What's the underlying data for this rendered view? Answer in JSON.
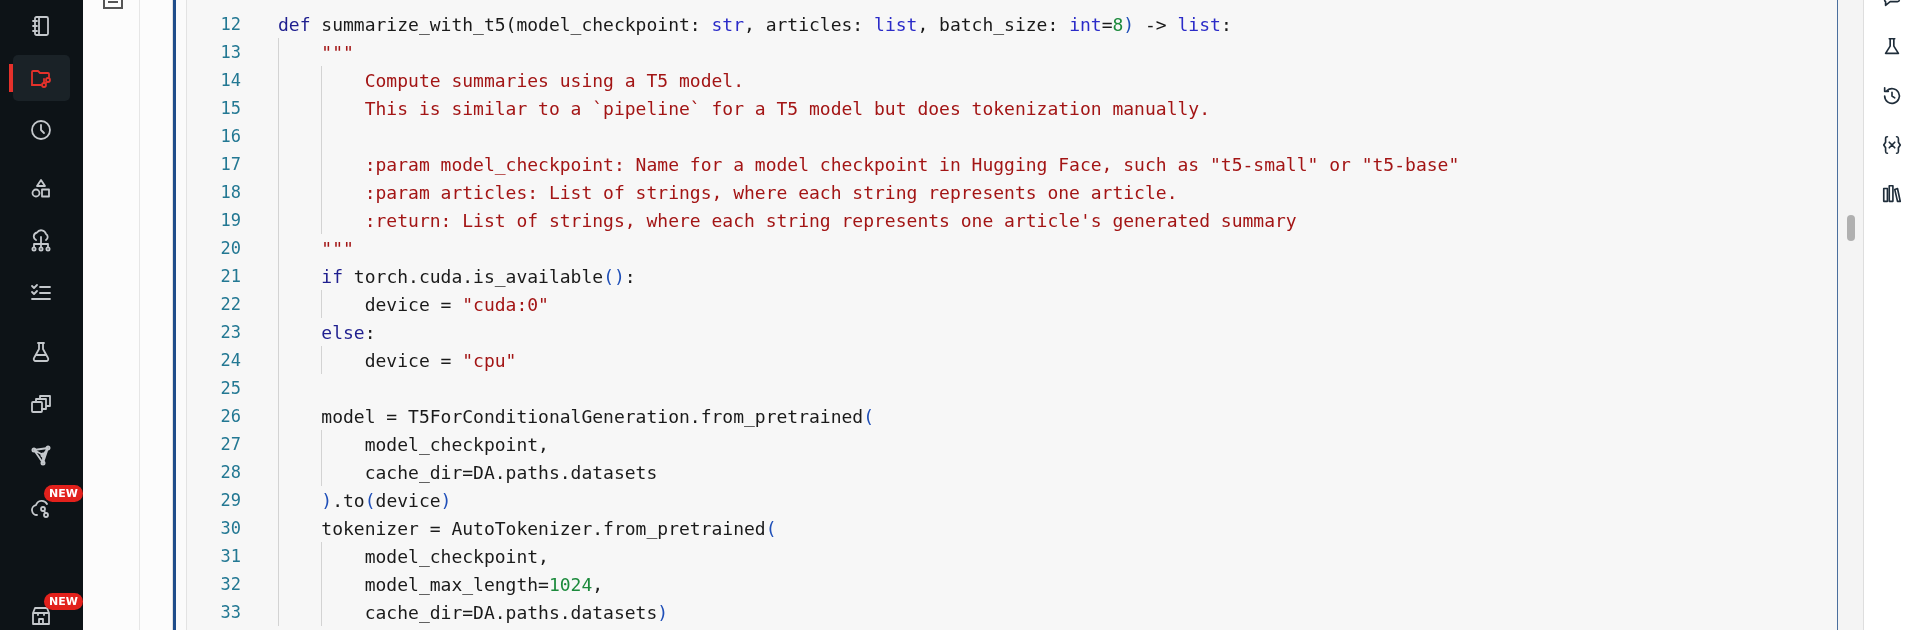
{
  "nav": {
    "groups": [
      {
        "items": [
          {
            "selected": false
          },
          {
            "selected": true
          },
          {
            "selected": false
          }
        ]
      },
      {
        "items": [
          {
            "selected": false
          },
          {
            "selected": false
          },
          {
            "selected": false
          }
        ]
      },
      {
        "items": [
          {
            "selected": false
          },
          {
            "selected": false
          },
          {
            "selected": false
          },
          {
            "selected": false,
            "badge": "NEW"
          }
        ]
      },
      {
        "items": [
          {
            "selected": false,
            "badge": "NEW"
          }
        ]
      }
    ]
  },
  "editor": {
    "lines": [
      {
        "number": "12",
        "tokens": [
          {
            "kind": "kw",
            "text": "def"
          },
          {
            "kind": "plain",
            "text": " summarize_with_t5(model_checkpoint: "
          },
          {
            "kind": "type",
            "text": "str"
          },
          {
            "kind": "plain",
            "text": ", articles: "
          },
          {
            "kind": "type",
            "text": "list"
          },
          {
            "kind": "plain",
            "text": ", batch_size: "
          },
          {
            "kind": "type",
            "text": "int"
          },
          {
            "kind": "plain",
            "text": "="
          },
          {
            "kind": "num",
            "text": "8"
          },
          {
            "kind": "paren",
            "text": ")"
          },
          {
            "kind": "plain",
            "text": " -> "
          },
          {
            "kind": "type",
            "text": "list"
          },
          {
            "kind": "plain",
            "text": ":"
          }
        ]
      },
      {
        "number": "13",
        "tokens": [
          {
            "kind": "str",
            "text": "    \"\"\""
          }
        ]
      },
      {
        "number": "14",
        "tokens": [
          {
            "kind": "str",
            "text": "        Compute summaries using a T5 model."
          }
        ]
      },
      {
        "number": "15",
        "tokens": [
          {
            "kind": "str",
            "text": "        This is similar to a `pipeline` for a T5 model but does tokenization manually."
          }
        ]
      },
      {
        "number": "16"
      },
      {
        "number": "17",
        "tokens": [
          {
            "kind": "str",
            "text": "        :param model_checkpoint: Name for a model checkpoint in Hugging Face, such as \"t5-small\" or \"t5-base\""
          }
        ]
      },
      {
        "number": "18",
        "tokens": [
          {
            "kind": "str",
            "text": "        :param articles: List of strings, where each string represents one article."
          }
        ]
      },
      {
        "number": "19",
        "tokens": [
          {
            "kind": "str",
            "text": "        :return: List of strings, where each string represents one article's generated summary"
          }
        ]
      },
      {
        "number": "20",
        "tokens": [
          {
            "kind": "str",
            "text": "    \"\"\""
          }
        ]
      },
      {
        "number": "21",
        "tokens": [
          {
            "kind": "kw",
            "text": "    if"
          },
          {
            "kind": "plain",
            "text": " torch.cuda.is_available"
          },
          {
            "kind": "paren",
            "text": "()"
          },
          {
            "kind": "plain",
            "text": ":"
          }
        ]
      },
      {
        "number": "22",
        "tokens": [
          {
            "kind": "plain",
            "text": "        device = "
          },
          {
            "kind": "str",
            "text": "\"cuda:0\""
          }
        ]
      },
      {
        "number": "23",
        "tokens": [
          {
            "kind": "kw",
            "text": "    else"
          },
          {
            "kind": "plain",
            "text": ":"
          }
        ]
      },
      {
        "number": "24",
        "tokens": [
          {
            "kind": "plain",
            "text": "        device = "
          },
          {
            "kind": "str",
            "text": "\"cpu\""
          }
        ]
      },
      {
        "number": "25"
      },
      {
        "number": "26",
        "tokens": [
          {
            "kind": "plain",
            "text": "    model = T5ForConditionalGeneration.from_pretrained"
          },
          {
            "kind": "paren",
            "text": "("
          }
        ]
      },
      {
        "number": "27",
        "tokens": [
          {
            "kind": "plain",
            "text": "        model_checkpoint,"
          }
        ]
      },
      {
        "number": "28",
        "tokens": [
          {
            "kind": "plain",
            "text": "        cache_dir=DA.paths.datasets"
          }
        ]
      },
      {
        "number": "29",
        "tokens": [
          {
            "kind": "paren",
            "text": "    )"
          },
          {
            "kind": "plain",
            "text": ".to"
          },
          {
            "kind": "paren",
            "text": "("
          },
          {
            "kind": "plain",
            "text": "device"
          },
          {
            "kind": "paren",
            "text": ")"
          }
        ]
      },
      {
        "number": "30",
        "tokens": [
          {
            "kind": "plain",
            "text": "    tokenizer = AutoTokenizer.from_pretrained"
          },
          {
            "kind": "paren",
            "text": "("
          }
        ]
      },
      {
        "number": "31",
        "tokens": [
          {
            "kind": "plain",
            "text": "        model_checkpoint,"
          }
        ]
      },
      {
        "number": "32",
        "tokens": [
          {
            "kind": "plain",
            "text": "        model_max_length="
          },
          {
            "kind": "num",
            "text": "1024"
          },
          {
            "kind": "plain",
            "text": ","
          }
        ]
      },
      {
        "number": "33",
        "tokens": [
          {
            "kind": "plain",
            "text": "        cache_dir=DA.paths.datasets"
          },
          {
            "kind": "paren",
            "text": ")"
          }
        ]
      }
    ]
  }
}
